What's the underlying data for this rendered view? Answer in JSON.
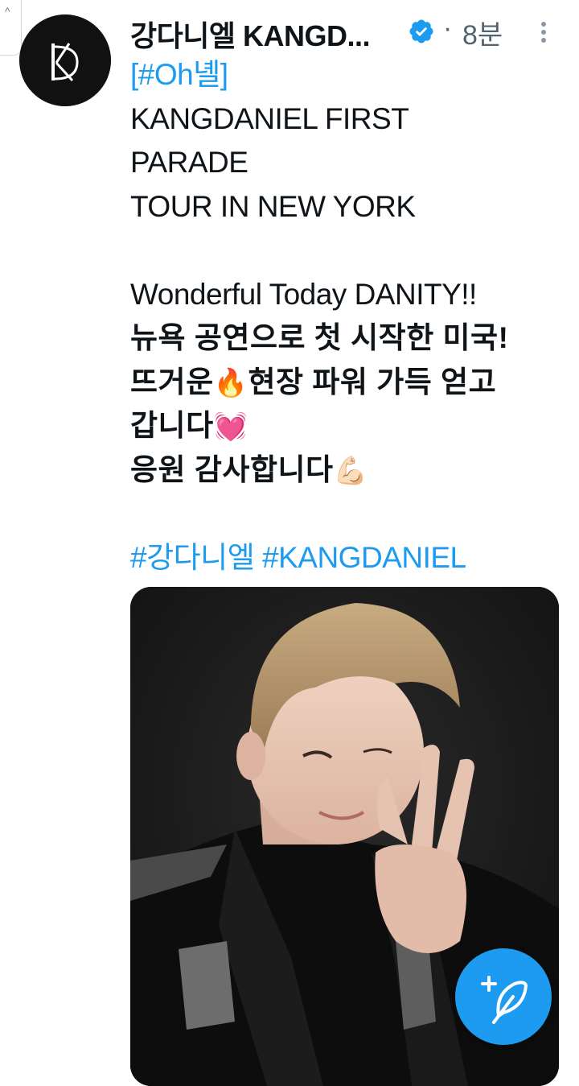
{
  "tweet": {
    "author": {
      "display_name": "강다니엘 KANGD...",
      "verified": true,
      "avatar_icon": "kd-logo-avatar"
    },
    "separator": "·",
    "time": "8분",
    "lines": [
      {
        "text": "[",
        "link": "#Oh녤",
        "suffix": "]"
      },
      {
        "text": "KANGDANIEL FIRST"
      },
      {
        "text": "PARADE"
      },
      {
        "text": "TOUR IN NEW YORK"
      },
      {
        "text": ""
      },
      {
        "text": "Wonderful Today DANITY!!"
      },
      {
        "text": "뉴욕 공연으로 첫 시작한 미국!"
      },
      {
        "text": "뜨거운",
        "emoji": "🔥",
        "suffix": "현장 파워 가득 얻고"
      },
      {
        "text": "갑니다",
        "emoji": "💓"
      },
      {
        "text": "응원 감사합니다",
        "emoji": "💪🏻"
      },
      {
        "text": ""
      },
      {
        "hashtags": [
          "#강다니엘",
          "#KANGDANIEL"
        ]
      }
    ],
    "media": {
      "icon": "photo-thumbnail"
    }
  },
  "fab": {
    "icon": "compose-tweet-icon"
  },
  "colors": {
    "link": "#1d9bf0",
    "text": "#0f1419",
    "secondary": "#536471",
    "fab": "#1d9bf0"
  }
}
